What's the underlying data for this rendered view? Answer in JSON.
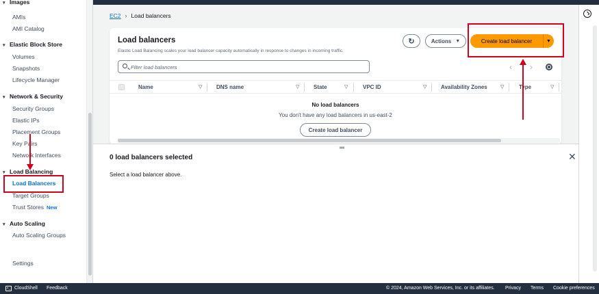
{
  "sidebar": {
    "top_item": "Images",
    "images_items": [
      "AMIs",
      "AMI Catalog"
    ],
    "ebs": {
      "title": "Elastic Block Store",
      "items": [
        "Volumes",
        "Snapshots",
        "Lifecycle Manager"
      ]
    },
    "network": {
      "title": "Network & Security",
      "items": [
        "Security Groups",
        "Elastic IPs",
        "Placement Groups",
        "Key Pairs",
        "Network Interfaces"
      ]
    },
    "lb": {
      "title": "Load Balancing",
      "items": [
        "Load Balancers",
        "Target Groups",
        "Trust Stores"
      ],
      "new_badge": "New"
    },
    "autoscaling": {
      "title": "Auto Scaling",
      "items": [
        "Auto Scaling Groups"
      ]
    },
    "settings": "Settings"
  },
  "breadcrumb": {
    "root": "EC2",
    "current": "Load balancers"
  },
  "panel": {
    "title": "Load balancers",
    "description": "Elastic Load Balancing scales your load balancer capacity automatically in response to changes in incoming traffic.",
    "actions_label": "Actions",
    "create_label": "Create load balancer",
    "search_placeholder": "Filter load balancers",
    "columns": [
      "Name",
      "DNS name",
      "State",
      "VPC ID",
      "Availability Zones",
      "Type"
    ],
    "empty_title": "No load balancers",
    "empty_sub": "You don't have any load balancers in us-east-2",
    "empty_button": "Create load balancer"
  },
  "split": {
    "title": "0 load balancers selected",
    "subtitle": "Select a load balancer above."
  },
  "footer": {
    "cloudshell": "CloudShell",
    "feedback": "Feedback",
    "copyright": "© 2024, Amazon Web Services, Inc. or its affiliates.",
    "privacy": "Privacy",
    "terms": "Terms",
    "cookies": "Cookie preferences"
  },
  "colors": {
    "primary_button": "#ff9900",
    "annotation": "#d0021b",
    "link": "#0972d3",
    "topbar": "#232f3e"
  }
}
